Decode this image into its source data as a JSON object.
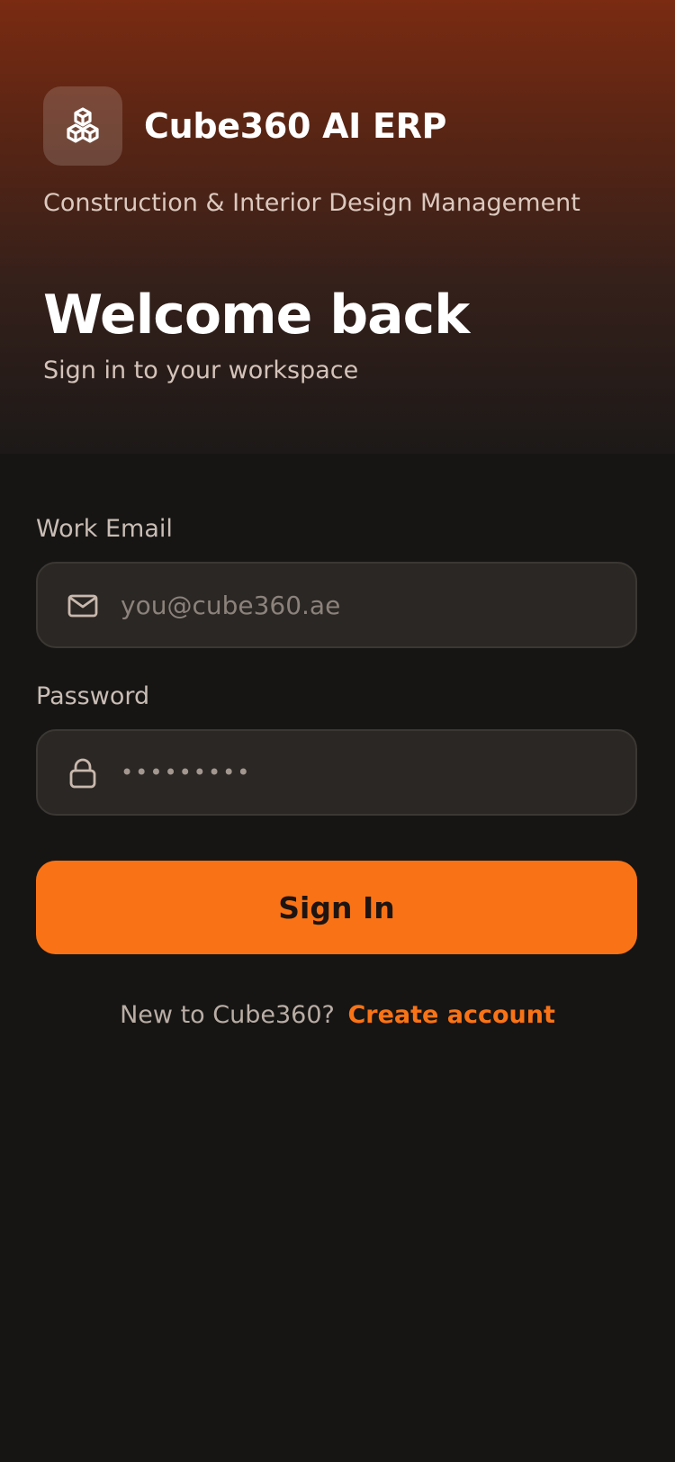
{
  "brand": {
    "app_title": "Cube360 AI ERP",
    "tagline": "Construction & Interior Design Management",
    "logo_icon": "cubes-icon"
  },
  "hero": {
    "heading": "Welcome back",
    "subheading": "Sign in to your workspace"
  },
  "form": {
    "email": {
      "label": "Work Email",
      "placeholder": "you@cube360.ae",
      "value": "",
      "icon": "mail-icon"
    },
    "password": {
      "label": "Password",
      "placeholder": "•••••••••",
      "value": "",
      "icon": "lock-icon"
    },
    "submit_label": "Sign In"
  },
  "signup": {
    "prompt": "New to Cube360?",
    "link_label": "Create account"
  },
  "colors": {
    "accent": "#f97316",
    "background": "#161514",
    "hero_top": "#7a2b12",
    "input_bg": "#2a2724"
  }
}
